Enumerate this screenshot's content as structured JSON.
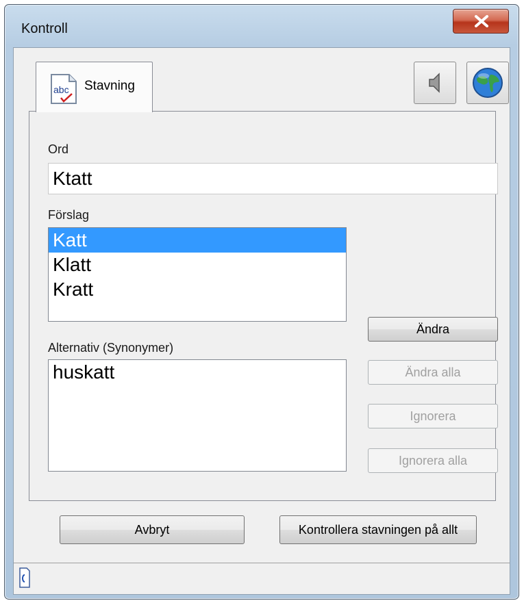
{
  "window": {
    "title": "Kontroll"
  },
  "tabs": [
    {
      "label": "Stavning",
      "icon": "abc-spellcheck-icon"
    }
  ],
  "toolbar": {
    "speaker_icon": "speaker-icon",
    "globe_icon": "globe-icon"
  },
  "word": {
    "label": "Ord",
    "value": "Ktatt"
  },
  "suggestions": {
    "label": "Förslag",
    "items": [
      "Katt",
      "Klatt",
      "Kratt"
    ],
    "selected_index": 0
  },
  "synonyms": {
    "label": "Alternativ (Synonymer)",
    "items": [
      "huskatt"
    ]
  },
  "actions": {
    "change": "Ändra",
    "change_all": "Ändra alla",
    "ignore": "Ignorera",
    "ignore_all": "Ignorera alla"
  },
  "footer": {
    "cancel": "Avbryt",
    "check_all": "Kontrollera stavningen på allt"
  },
  "colors": {
    "selection": "#3399ff",
    "close_button": "#c8573c"
  }
}
